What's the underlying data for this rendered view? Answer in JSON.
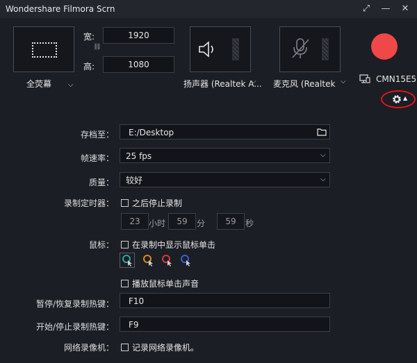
{
  "window": {
    "title": "Wondershare Filmora Scrn",
    "restore_glyph": "⤢",
    "minimize_glyph": "—",
    "close_glyph": "✕"
  },
  "capture": {
    "mode_label": "全荧幕",
    "width_label": "宽:",
    "height_label": "高:",
    "width_value": "1920",
    "height_value": "1080",
    "link_glyph": "⛓"
  },
  "audio": {
    "speaker_label": "扬声器 (Realtek A...",
    "mic_label": "麦克风 (Realtek A..."
  },
  "camera": {
    "label": "CMN15E5"
  },
  "colors": {
    "record": "#f04848",
    "highlight_ring": "#e0141e",
    "cursor_teal": "#2aa8a0",
    "cursor_orange": "#d98a1e",
    "cursor_red": "#d23a3a",
    "cursor_blue": "#3a5fd2"
  },
  "settings": {
    "save_to_label": "存档至：",
    "save_to_value": "E:/Desktop",
    "frame_rate_label": "帧速率：",
    "frame_rate_value": "25 fps",
    "quality_label": "质量：",
    "quality_value": "较好",
    "timer_label": "录制定时器：",
    "timer_checkbox": "之后停止录制",
    "timer_hours": "23",
    "timer_hours_unit": "小时",
    "timer_minutes": "59",
    "timer_minutes_unit": "分",
    "timer_seconds": "59",
    "timer_seconds_unit": "秒",
    "mouse_label": "鼠标：",
    "mouse_show_clicks": "在录制中显示鼠标单击",
    "mouse_click_sound": "播放鼠标单击声音",
    "pause_hotkey_label": "暂停/恢复录制热键：",
    "pause_hotkey_value": "F10",
    "start_hotkey_label": "开始/停止录制热键：",
    "start_hotkey_value": "F9",
    "webcam_label": "网络录像机：",
    "webcam_checkbox": "记录网络录像机。"
  }
}
